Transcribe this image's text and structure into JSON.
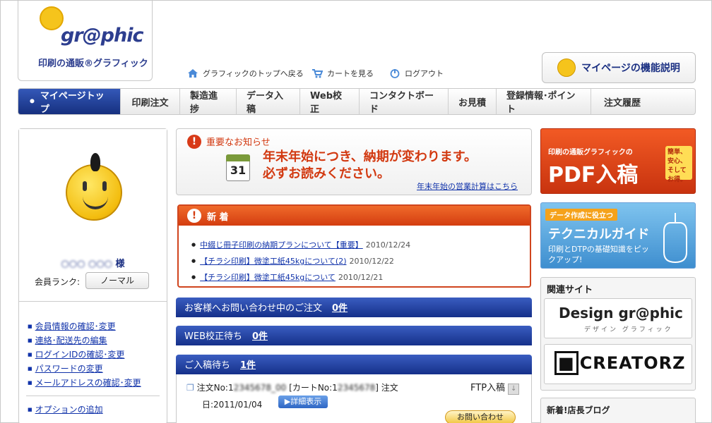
{
  "header": {
    "logo_text": "gr@phic",
    "logo_sub": "印刷の通販®グラフィック",
    "top_links": [
      {
        "icon": "home-icon",
        "label": "グラフィックのトップへ戻る"
      },
      {
        "icon": "cart-icon",
        "label": "カートを見る"
      },
      {
        "icon": "power-icon",
        "label": "ログアウト"
      }
    ],
    "mypage_help": "マイページの機能説明"
  },
  "global_nav": [
    "マイページトップ",
    "印刷注文",
    "製造進捗",
    "データ入稿",
    "Web校正",
    "コンタクトボード",
    "お見積",
    "登録情報･ポイント",
    "注文履歴"
  ],
  "left": {
    "user_name": "様",
    "rank_label": "会員ランク:",
    "rank_value": "ノーマル",
    "links": [
      "会員情報の確認･変更",
      "連絡･配送先の編集",
      "ログインIDの確認･変更",
      "パスワードの変更",
      "メールアドレスの確認･変更"
    ],
    "option_link": "オプションの追加"
  },
  "notice": {
    "title": "重要なお知らせ",
    "calendar_day": "31",
    "message_line1": "年末年始につき、納期が変わります。",
    "message_line2": "必ずお読みください。",
    "link": "年末年始の営業計算はこちら"
  },
  "news": {
    "title": "新 着",
    "items": [
      {
        "text": "中綴じ冊子印刷の納期プランについて【重要】",
        "date": "2010/12/24"
      },
      {
        "text": "【チラシ印刷】微塗工紙45kgについて(2)",
        "date": "2010/12/22"
      },
      {
        "text": "【チラシ印刷】微塗工紙45kgについて",
        "date": "2010/12/21"
      }
    ]
  },
  "status_bars": [
    {
      "label": "お客様へお問い合わせ中のご注文",
      "count": "0件"
    },
    {
      "label": "WEB校正待ち",
      "count": "0件"
    },
    {
      "label": "ご入稿待ち",
      "count": "1件"
    }
  ],
  "order": {
    "line1_prefix": "注文No:1",
    "line1_mid": "[カートNo:1",
    "line1_suffix": "] 注文",
    "line2": "日:2011/01/04",
    "detail_button": "▶詳細表示",
    "ftp_label": "FTP入稿",
    "inquiry_button": "お問い合わせ"
  },
  "right": {
    "pdf_small": "印刷の通販グラフィックの",
    "pdf_big": "PDF入稿",
    "pdf_tag": "簡単、安心、そしてお得。",
    "tech_small": "データ作成に役立つ",
    "tech_big": "テクニカルガイド",
    "tech_desc": "印刷とDTPの基礎知識をピックアップ!",
    "related_title": "関連サイト",
    "site1": "Design gr@phic",
    "site1_sub": "デザイン グラフィック",
    "site2": "CREATORZ",
    "blog_title": "新着!店長ブログ"
  }
}
